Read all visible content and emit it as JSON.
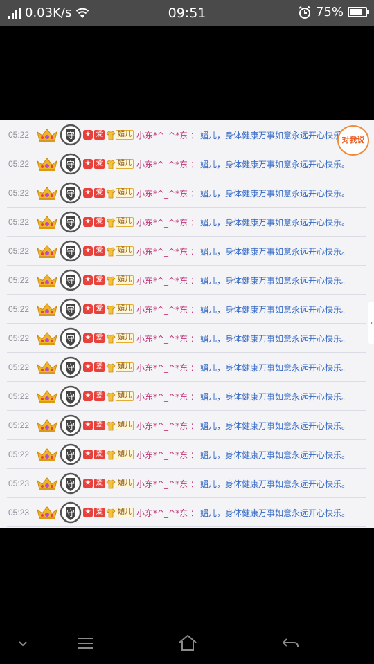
{
  "status_bar": {
    "network_speed": "0.03K/s",
    "time": "09:51",
    "battery_percent": "75%",
    "icons": [
      "signal-icon",
      "wifi-icon",
      "alarm-icon",
      "battery-icon"
    ]
  },
  "chat": {
    "rows": [
      {
        "time": "05:22",
        "badge_star": "★",
        "badge_ai": "爱",
        "badge_name": "媚儿",
        "sender": "小东*^_^*东 ：",
        "message": "媚儿，身体健康万事如意永远开心快乐。"
      },
      {
        "time": "05:22",
        "badge_star": "★",
        "badge_ai": "爱",
        "badge_name": "媚儿",
        "sender": "小东*^_^*东 ：",
        "message": "媚儿，身体健康万事如意永远开心快乐。"
      },
      {
        "time": "05:22",
        "badge_star": "★",
        "badge_ai": "爱",
        "badge_name": "媚儿",
        "sender": "小东*^_^*东 ：",
        "message": "媚儿，身体健康万事如意永远开心快乐。"
      },
      {
        "time": "05:22",
        "badge_star": "★",
        "badge_ai": "爱",
        "badge_name": "媚儿",
        "sender": "小东*^_^*东 ：",
        "message": "媚儿，身体健康万事如意永远开心快乐。"
      },
      {
        "time": "05:22",
        "badge_star": "★",
        "badge_ai": "爱",
        "badge_name": "媚儿",
        "sender": "小东*^_^*东 ：",
        "message": "媚儿，身体健康万事如意永远开心快乐。"
      },
      {
        "time": "05:22",
        "badge_star": "★",
        "badge_ai": "爱",
        "badge_name": "媚儿",
        "sender": "小东*^_^*东 ：",
        "message": "媚儿，身体健康万事如意永远开心快乐。"
      },
      {
        "time": "05:22",
        "badge_star": "★",
        "badge_ai": "爱",
        "badge_name": "媚儿",
        "sender": "小东*^_^*东 ：",
        "message": "媚儿，身体健康万事如意永远开心快乐。"
      },
      {
        "time": "05:22",
        "badge_star": "★",
        "badge_ai": "爱",
        "badge_name": "媚儿",
        "sender": "小东*^_^*东 ：",
        "message": "媚儿，身体健康万事如意永远开心快乐。"
      },
      {
        "time": "05:22",
        "badge_star": "★",
        "badge_ai": "爱",
        "badge_name": "媚儿",
        "sender": "小东*^_^*东 ：",
        "message": "媚儿，身体健康万事如意永远开心快乐。"
      },
      {
        "time": "05:22",
        "badge_star": "★",
        "badge_ai": "爱",
        "badge_name": "媚儿",
        "sender": "小东*^_^*东 ：",
        "message": "媚儿，身体健康万事如意永远开心快乐。"
      },
      {
        "time": "05:22",
        "badge_star": "★",
        "badge_ai": "爱",
        "badge_name": "媚儿",
        "sender": "小东*^_^*东 ：",
        "message": "媚儿，身体健康万事如意永远开心快乐。"
      },
      {
        "time": "05:22",
        "badge_star": "★",
        "badge_ai": "爱",
        "badge_name": "媚儿",
        "sender": "小东*^_^*东 ：",
        "message": "媚儿，身体健康万事如意永远开心快乐。"
      },
      {
        "time": "05:23",
        "badge_star": "★",
        "badge_ai": "爱",
        "badge_name": "媚儿",
        "sender": "小东*^_^*东 ：",
        "message": "媚儿，身体健康万事如意永远开心快乐。"
      },
      {
        "time": "05:23",
        "badge_star": "★",
        "badge_ai": "爱",
        "badge_name": "媚儿",
        "sender": "小东*^_^*东 ：",
        "message": "媚儿，身体健康万事如意永远开心快乐。"
      }
    ],
    "row_icons": [
      "crown-icon",
      "guard-shield-icon",
      "shirt-icon"
    ]
  },
  "say_to_me_label": "对我说",
  "nav_bar": {
    "icons": [
      "chevron-down-icon",
      "menu-icon",
      "home-icon",
      "back-icon"
    ]
  },
  "colors": {
    "status_bar_bg": "#4a4a4a",
    "sender": "#c0397b",
    "message": "#3468c4",
    "badge_red": "#e8403a",
    "bubble_border": "#f08a3c"
  }
}
